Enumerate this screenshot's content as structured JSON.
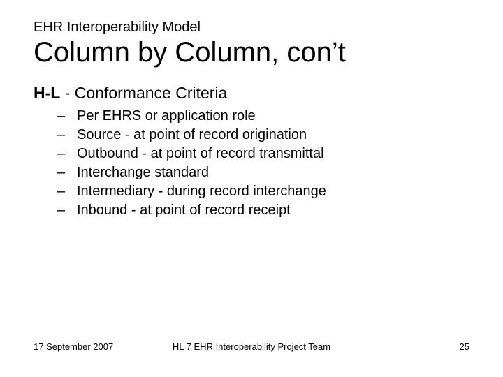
{
  "supertitle": "EHR Interoperability Model",
  "title": "Column by Column, con’t",
  "section": {
    "label_bold": "H-L",
    "label_rest": " - Conformance Criteria"
  },
  "bullets": [
    "Per EHRS or application role",
    "Source - at point of record origination",
    "Outbound - at point of record transmittal",
    "Interchange standard",
    "Intermediary - during record interchange",
    "Inbound - at point of record receipt"
  ],
  "footer": {
    "date": "17 September 2007",
    "center": "HL 7 EHR Interoperability Project Team",
    "page": "25"
  },
  "dash": "–"
}
